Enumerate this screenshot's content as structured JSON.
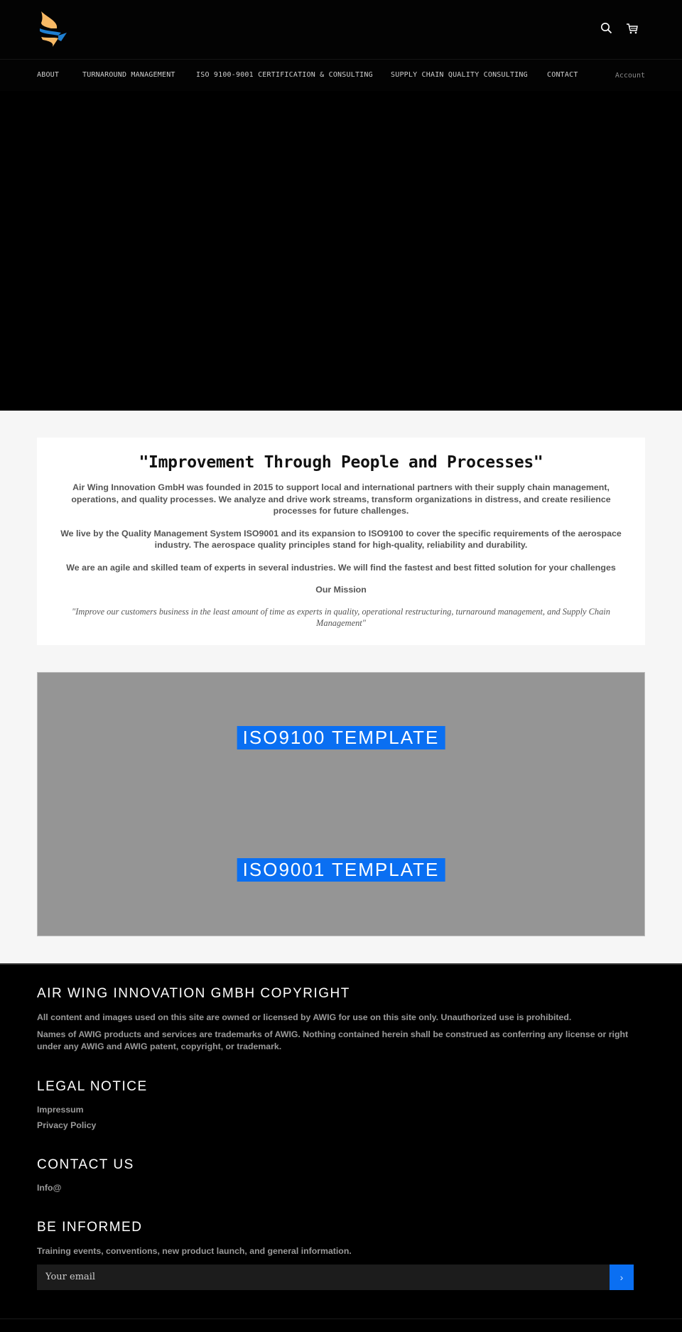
{
  "header": {
    "logo_alt": "Air Wing Innovation logo",
    "icons": [
      "search-icon",
      "cart-icon"
    ]
  },
  "nav": {
    "items": [
      {
        "label": "ABOUT"
      },
      {
        "label": "TURNAROUND MANAGEMENT"
      },
      {
        "label": "ISO 9100-9001 CERTIFICATION & CONSULTING"
      },
      {
        "label": "SUPPLY CHAIN QUALITY CONSULTING"
      },
      {
        "label": "CONTACT"
      }
    ],
    "account_label": "Account"
  },
  "intro": {
    "title": "\"Improvement Through People and Processes\"",
    "paragraphs": [
      "Air Wing Innovation GmbH was founded in 2015 to support local and international partners with their supply chain management, operations, and quality processes. We analyze and drive work streams, transform organizations in distress, and create resilience processes for future challenges.",
      "We live by the Quality Management System ISO9001 and its expansion to ISO9100 to cover the specific requirements of the aerospace industry. The aerospace quality principles stand for high-quality, reliability and durability.",
      "We are an agile and skilled team of experts in several industries. We will find the fastest and best fitted solution for your challenges"
    ],
    "mission_title": "Our Mission",
    "mission_quote": "\"Improve our customers business in the least amount of time as experts in quality, operational restructuring, turnaround management, and Supply Chain Management\""
  },
  "templates": {
    "items": [
      {
        "label": "ISO9100 TEMPLATE"
      },
      {
        "label": "ISO9001 TEMPLATE"
      }
    ]
  },
  "footer": {
    "copyright": {
      "title": "AIR WING INNOVATION GMBH COPYRIGHT",
      "paragraphs": [
        "All content and images used on this site are owned or licensed by AWIG for use on this site only. Unauthorized use is prohibited.",
        "Names of AWIG products and services are trademarks of AWIG. Nothing contained herein shall be construed as conferring any license or right under any AWIG and AWIG patent, copyright, or trademark."
      ]
    },
    "legal": {
      "title": "LEGAL NOTICE",
      "links": [
        {
          "label": "Impressum"
        },
        {
          "label": "Privacy Policy"
        }
      ]
    },
    "contact": {
      "title": "CONTACT US",
      "email_label": "Info@"
    },
    "newsletter": {
      "title": "BE INFORMED",
      "description": "Training events, conventions, new product launch, and general information.",
      "email_placeholder": "Your email",
      "submit_icon": "chevron-right-icon"
    }
  },
  "colors": {
    "accent": "#0a6ff2",
    "background_dark": "#000000",
    "background_light": "#f6f6f6",
    "template_panel": "#959595",
    "logo_orange": "#f7b965",
    "logo_blue": "#1f7fd1"
  }
}
